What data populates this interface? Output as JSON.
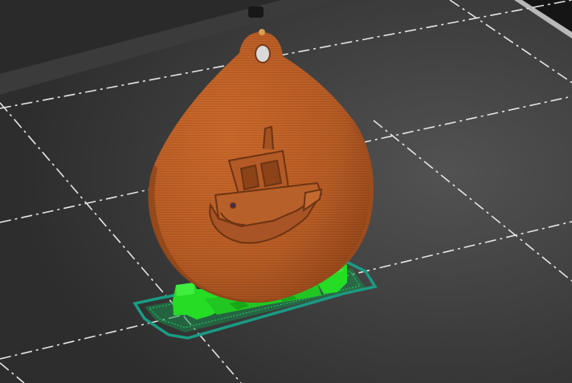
{
  "viewport": {
    "view_mode": "sliced-preview",
    "colors": {
      "bed_dark": "#2d2d2d",
      "bed_light": "#525252",
      "bed_edge": "#1c1c1c",
      "bed_rim_top": "#8d8d8d",
      "grid_line": "#e6e6e6",
      "part_fill": "#b85c25",
      "part_highlight": "#cc6a2c",
      "part_shadow": "#8e4518",
      "support": "#25dd25",
      "support_dark": "#17a717",
      "skirt_brim": "#1a9b83",
      "frame_dark": "#101010"
    },
    "objects": [
      {
        "name": "teardrop-keychain",
        "feature": "benchy-emboss"
      },
      {
        "name": "support-material"
      },
      {
        "name": "skirt-brim"
      }
    ]
  }
}
